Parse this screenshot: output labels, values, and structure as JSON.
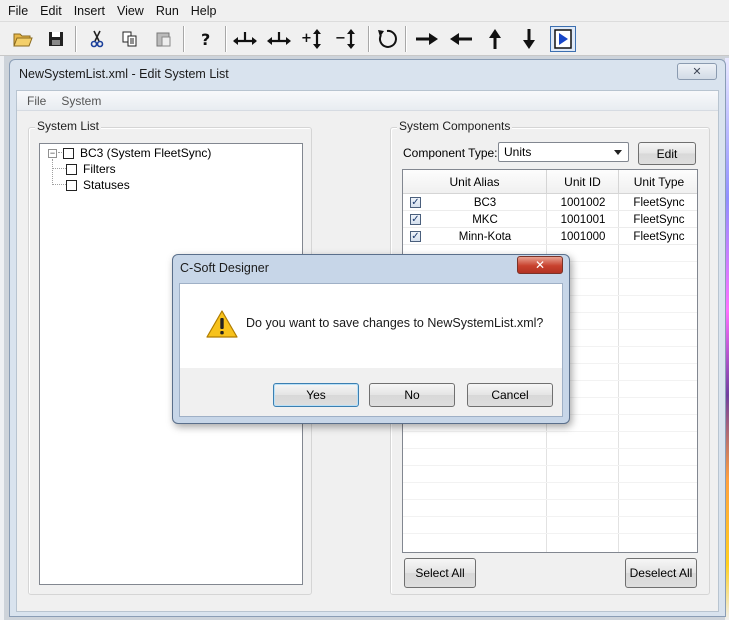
{
  "menubar": {
    "items": [
      "File",
      "Edit",
      "Insert",
      "View",
      "Run",
      "Help"
    ]
  },
  "toolbar": {
    "buttons": [
      {
        "name": "open-folder-icon"
      },
      {
        "name": "save-disk-icon"
      },
      {
        "name": "cut-scissors-icon"
      },
      {
        "name": "copy-icon"
      },
      {
        "name": "paste-icon"
      },
      {
        "name": "help-question-icon"
      },
      {
        "name": "expand-horizontal-icon"
      },
      {
        "name": "shrink-horizontal-icon"
      },
      {
        "name": "expand-vertical-icon"
      },
      {
        "name": "shrink-vertical-icon"
      },
      {
        "name": "rotate-icon"
      },
      {
        "name": "arrow-right-icon"
      },
      {
        "name": "arrow-left-icon"
      },
      {
        "name": "arrow-up-icon"
      },
      {
        "name": "arrow-down-icon"
      },
      {
        "name": "play-run-icon"
      }
    ]
  },
  "edit_window": {
    "title": "NewSystemList.xml - Edit System List",
    "close_glyph": "✕",
    "menu": [
      "File",
      "System"
    ],
    "system_list": {
      "label": "System List",
      "root": {
        "expander": "−",
        "label": "BC3  (System FleetSync)"
      },
      "children": [
        "Filters",
        "Statuses"
      ]
    },
    "system_components": {
      "label": "System Components",
      "component_type_label": "Component Type:",
      "component_type_value": "Units",
      "edit_button": "Edit",
      "columns": [
        "Unit Alias",
        "Unit ID",
        "Unit Type"
      ],
      "rows": [
        {
          "checked": true,
          "alias": "BC3",
          "id": "1001002",
          "type": "FleetSync"
        },
        {
          "checked": true,
          "alias": "MKC",
          "id": "1001001",
          "type": "FleetSync"
        },
        {
          "checked": true,
          "alias": "Minn-Kota",
          "id": "1001000",
          "type": "FleetSync"
        }
      ],
      "check_glyph": "✓",
      "select_all": "Select All",
      "deselect_all": "Deselect All"
    }
  },
  "dialog": {
    "title": "C-Soft Designer",
    "close_glyph": "✕",
    "icon": "warning-icon",
    "message": "Do you want to save changes to NewSystemList.xml?",
    "buttons": {
      "yes": "Yes",
      "no": "No",
      "cancel": "Cancel"
    },
    "default_button": "yes"
  },
  "colors": {
    "dialog_frame": "#c7d6e8",
    "close_red": "#c8422e",
    "default_button_border": "#3c7fb1"
  }
}
